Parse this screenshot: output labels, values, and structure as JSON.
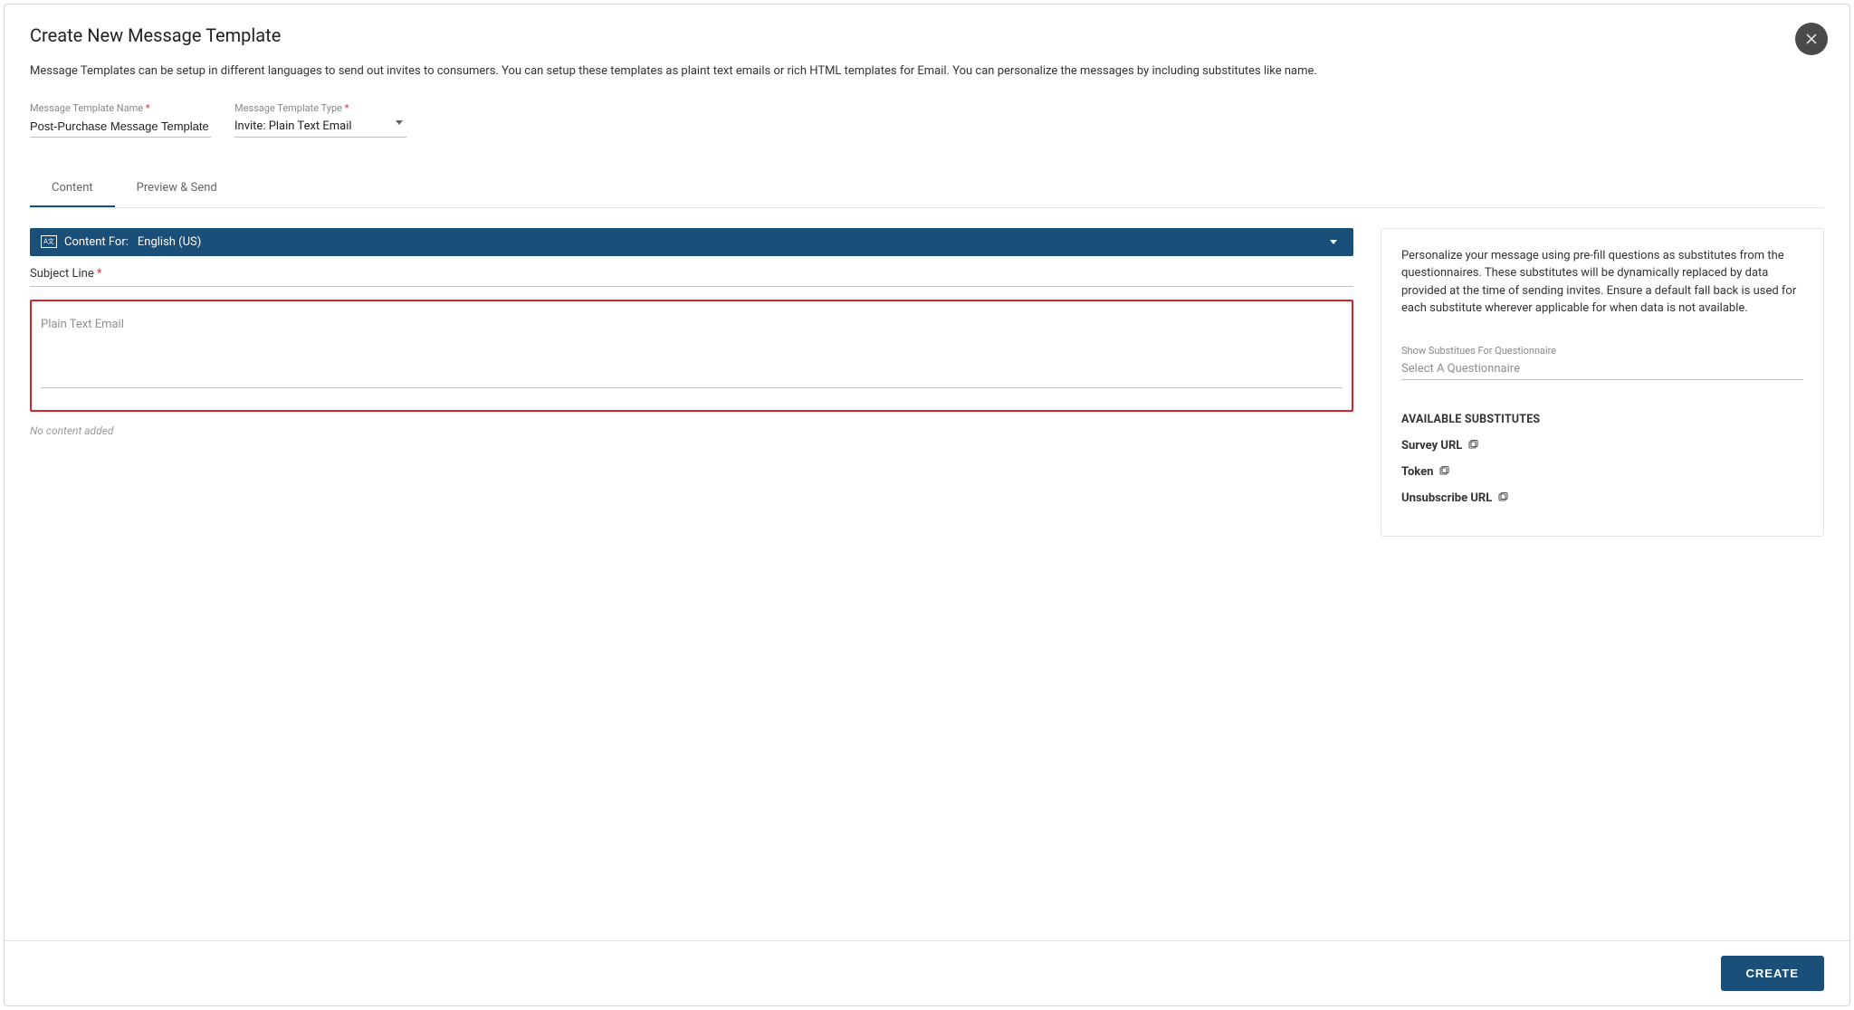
{
  "header": {
    "title": "Create New Message Template",
    "subtitle": "Message Templates can be setup in different languages to send out invites to consumers. You can setup these templates as plaint text emails or rich HTML templates for Email. You can personalize the messages by including substitutes like name."
  },
  "fields": {
    "name_label": "Message Template Name",
    "name_value": "Post-Purchase Message Template",
    "type_label": "Message Template Type",
    "type_value": "Invite: Plain Text Email"
  },
  "tabs": {
    "content": "Content",
    "preview": "Preview & Send"
  },
  "content": {
    "content_for_label": "Content For:",
    "language": "English (US)",
    "subject_label": "Subject Line",
    "body_placeholder": "Plain Text Email",
    "no_content": "No content added"
  },
  "personalize": {
    "description": "Personalize your message using pre-fill questions as substitutes from the questionnaires. These substitutes will be dynamically replaced by data provided at the time of sending invites. Ensure a default fall back is used for each substitute wherever applicable for when data is not available.",
    "show_subs_label": "Show Substitues For Questionnaire",
    "select_placeholder": "Select A Questionnaire",
    "available_header": "AVAILABLE SUBSTITUTES",
    "items": {
      "0": "Survey URL",
      "1": "Token",
      "2": "Unsubscribe URL"
    }
  },
  "footer": {
    "create": "CREATE"
  }
}
